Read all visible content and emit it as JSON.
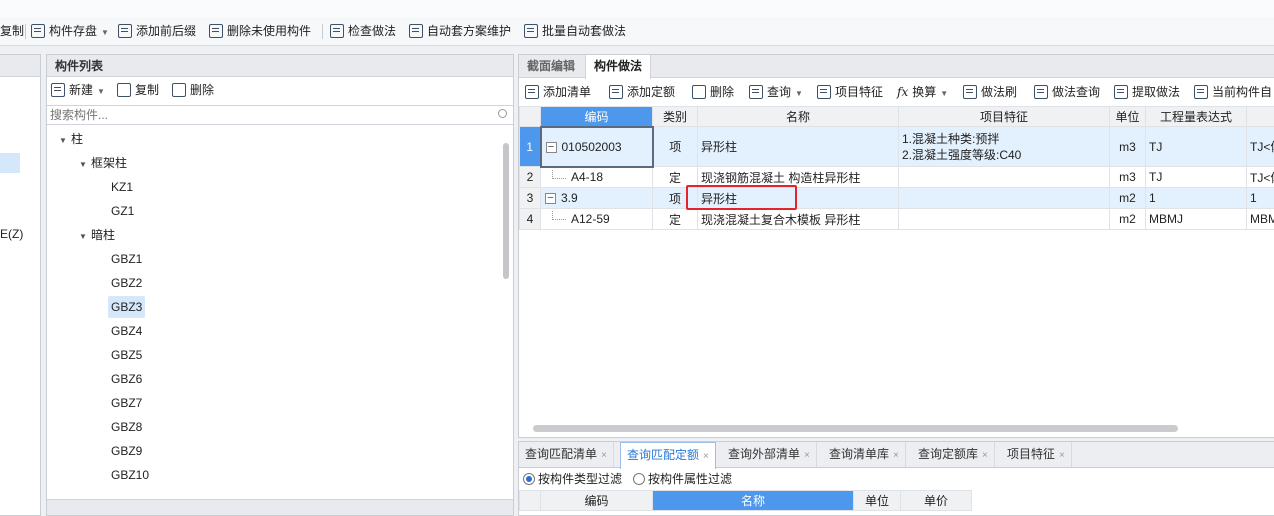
{
  "toolbar": {
    "items": [
      "复制",
      "构件存盘",
      "添加前后缀",
      "删除未使用构件",
      "检查做法",
      "自动套方案维护",
      "批量自动套做法"
    ]
  },
  "left_edge": {
    "item": "E(Z)"
  },
  "component_list": {
    "title": "构件列表",
    "new_label": "新建",
    "copy_label": "复制",
    "delete_label": "删除",
    "search_placeholder": "搜索构件...",
    "tree": {
      "root": "柱",
      "group1": "框架柱",
      "group1_items": [
        "KZ1",
        "GZ1"
      ],
      "group2": "暗柱",
      "group2_items": [
        "GBZ1",
        "GBZ2",
        "GBZ3",
        "GBZ4",
        "GBZ5",
        "GBZ6",
        "GBZ7",
        "GBZ8",
        "GBZ9",
        "GBZ10"
      ]
    }
  },
  "method_panel": {
    "tabs": [
      "截面编辑",
      "构件做法"
    ],
    "active_tab": "构件做法",
    "toolbar": [
      "添加清单",
      "添加定额",
      "删除",
      "查询",
      "项目特征",
      "换算",
      "做法刷",
      "做法查询",
      "提取做法",
      "当前构件自"
    ],
    "columns": [
      "编码",
      "类别",
      "名称",
      "项目特征",
      "单位",
      "工程量表达式",
      ""
    ],
    "rows": [
      {
        "num": "1",
        "code": "010502003",
        "type": "项",
        "name": "异形柱",
        "feature1": "1.混凝土种类:预拌",
        "feature2": "2.混凝土强度等级:C40",
        "unit": "m3",
        "expr": "TJ",
        "extra": "TJ<体"
      },
      {
        "num": "2",
        "code": "A4-18",
        "type": "定",
        "name": "现浇钢筋混凝土 构造柱异形柱",
        "feature1": "",
        "feature2": "",
        "unit": "m3",
        "expr": "TJ",
        "extra": "TJ<体"
      },
      {
        "num": "3",
        "code": "3.9",
        "type": "项",
        "name": "异形柱",
        "feature1": "",
        "feature2": "",
        "unit": "m2",
        "expr": "1",
        "extra": "1"
      },
      {
        "num": "4",
        "code": "A12-59",
        "type": "定",
        "name": "现浇混凝土复合木模板 异形柱",
        "feature1": "",
        "feature2": "",
        "unit": "m2",
        "expr": "MBMJ",
        "extra": "MBM"
      }
    ]
  },
  "query_panel": {
    "tabs": [
      "查询匹配清单",
      "查询匹配定额",
      "查询外部清单",
      "查询清单库",
      "查询定额库",
      "项目特征"
    ],
    "active_tab": "查询匹配定额",
    "filter_type": "按构件类型过滤",
    "filter_attr": "按构件属性过滤",
    "columns": [
      "编码",
      "名称",
      "单位",
      "单价"
    ]
  },
  "colors": {
    "accent": "#4d97ec",
    "highlight_box": "#e0262a"
  }
}
